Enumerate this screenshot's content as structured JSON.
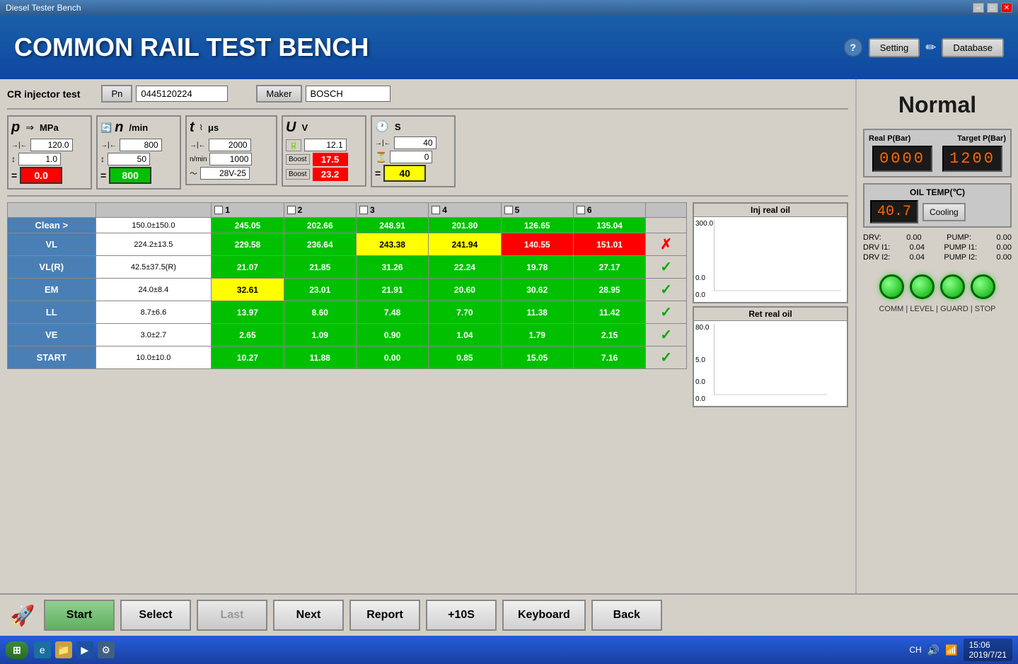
{
  "window": {
    "title": "Diesel Tester Bench"
  },
  "header": {
    "title": "COMMON RAIL TEST BENCH",
    "help_label": "?",
    "setting_label": "Setting",
    "database_label": "Database"
  },
  "cr_row": {
    "label": "CR injector test",
    "pn_label": "Pn",
    "pn_value": "0445120224",
    "maker_label": "Maker",
    "maker_value": "BOSCH"
  },
  "measurements": {
    "p": {
      "symbol": "p",
      "unit": "MPa",
      "setpoint": "120.0",
      "step": "1.0",
      "actual": "0.0",
      "actual_color": "red"
    },
    "n": {
      "symbol": "n",
      "unit": "/min",
      "setpoint": "800",
      "step": "50",
      "actual": "800",
      "actual_color": "green"
    },
    "t": {
      "symbol": "t",
      "unit": "μs",
      "setpoint": "2000",
      "step": "1000",
      "wave": "28V-25"
    },
    "u": {
      "symbol": "U",
      "unit": "V",
      "setpoint": "12.1",
      "boost1": "17.5",
      "boost1_color": "red",
      "boost2": "23.2",
      "boost2_color": "red"
    },
    "s": {
      "symbol": "S",
      "unit": "S",
      "setpoint": "40",
      "hourglass": "0",
      "actual": "40",
      "actual_color": "yellow"
    }
  },
  "table": {
    "columns": [
      "1",
      "2",
      "3",
      "4",
      "5",
      "6"
    ],
    "rows": [
      {
        "label": "Clean >",
        "spec": "150.0±150.0",
        "values": [
          "245.05",
          "202.66",
          "248.91",
          "201.80",
          "126.65",
          "135.04"
        ],
        "colors": [
          "green",
          "green",
          "green",
          "green",
          "green",
          "green"
        ],
        "status": "none"
      },
      {
        "label": "VL",
        "spec": "224.2±13.5",
        "values": [
          "229.58",
          "236.64",
          "243.38",
          "241.94",
          "140.55",
          "151.01"
        ],
        "colors": [
          "green",
          "green",
          "yellow",
          "yellow",
          "red",
          "red"
        ],
        "status": "fail"
      },
      {
        "label": "VL(R)",
        "spec": "42.5±37.5(R)",
        "values": [
          "21.07",
          "21.85",
          "31.26",
          "22.24",
          "19.78",
          "27.17"
        ],
        "colors": [
          "green",
          "green",
          "green",
          "green",
          "green",
          "green"
        ],
        "status": "pass"
      },
      {
        "label": "EM",
        "spec": "24.0±8.4",
        "values": [
          "32.61",
          "23.01",
          "21.91",
          "20.60",
          "30.62",
          "28.95"
        ],
        "colors": [
          "yellow",
          "green",
          "green",
          "green",
          "green",
          "green"
        ],
        "status": "pass"
      },
      {
        "label": "LL",
        "spec": "8.7±6.6",
        "values": [
          "13.97",
          "8.60",
          "7.48",
          "7.70",
          "11.38",
          "11.42"
        ],
        "colors": [
          "green",
          "green",
          "green",
          "green",
          "green",
          "green"
        ],
        "status": "pass"
      },
      {
        "label": "VE",
        "spec": "3.0±2.7",
        "values": [
          "2.65",
          "1.09",
          "0.90",
          "1.04",
          "1.79",
          "2.15"
        ],
        "colors": [
          "green",
          "green",
          "green",
          "green",
          "green",
          "green"
        ],
        "status": "pass"
      },
      {
        "label": "START",
        "spec": "10.0±10.0",
        "values": [
          "10.27",
          "11.88",
          "0.00",
          "0.85",
          "15.05",
          "7.16"
        ],
        "colors": [
          "green",
          "green",
          "green",
          "green",
          "green",
          "green"
        ],
        "status": "pass"
      }
    ]
  },
  "charts": {
    "inj_title": "Inj real oil",
    "ret_title": "Ret real oil",
    "inj_max": "300.0",
    "inj_mid": "",
    "inj_min": "0.0",
    "inj_bottom": "0.0",
    "ret_max": "80.0",
    "ret_mid": "5.0",
    "ret_min": "0.0",
    "ret_bottom": "0.0"
  },
  "right_panel": {
    "status": "Normal",
    "real_p_label": "Real P(Bar)",
    "target_p_label": "Target P(Bar)",
    "real_p_value": "0000",
    "target_p_value": "1200",
    "oil_temp_label": "OIL TEMP(℃)",
    "oil_temp_value": "40.7",
    "cooling_label": "Cooling",
    "drv_label": "DRV:",
    "drv_value": "0.00",
    "pump_label": "PUMP:",
    "pump_value": "0.00",
    "drv_i1_label": "DRV I1:",
    "drv_i1_value": "0.04",
    "pump_i1_label": "PUMP I1:",
    "pump_i1_value": "0.00",
    "drv_i2_label": "DRV I2:",
    "drv_i2_value": "0.04",
    "pump_i2_label": "PUMP I2:",
    "pump_i2_value": "0.00",
    "status_labels": "COMM | LEVEL | GUARD | STOP"
  },
  "toolbar": {
    "start_label": "Start",
    "select_label": "Select",
    "last_label": "Last",
    "next_label": "Next",
    "report_label": "Report",
    "plus10s_label": "+10S",
    "keyboard_label": "Keyboard",
    "back_label": "Back"
  },
  "taskbar": {
    "start_label": "⊞",
    "time": "15:06",
    "date": "2019/7/21",
    "ch_label": "CH"
  }
}
